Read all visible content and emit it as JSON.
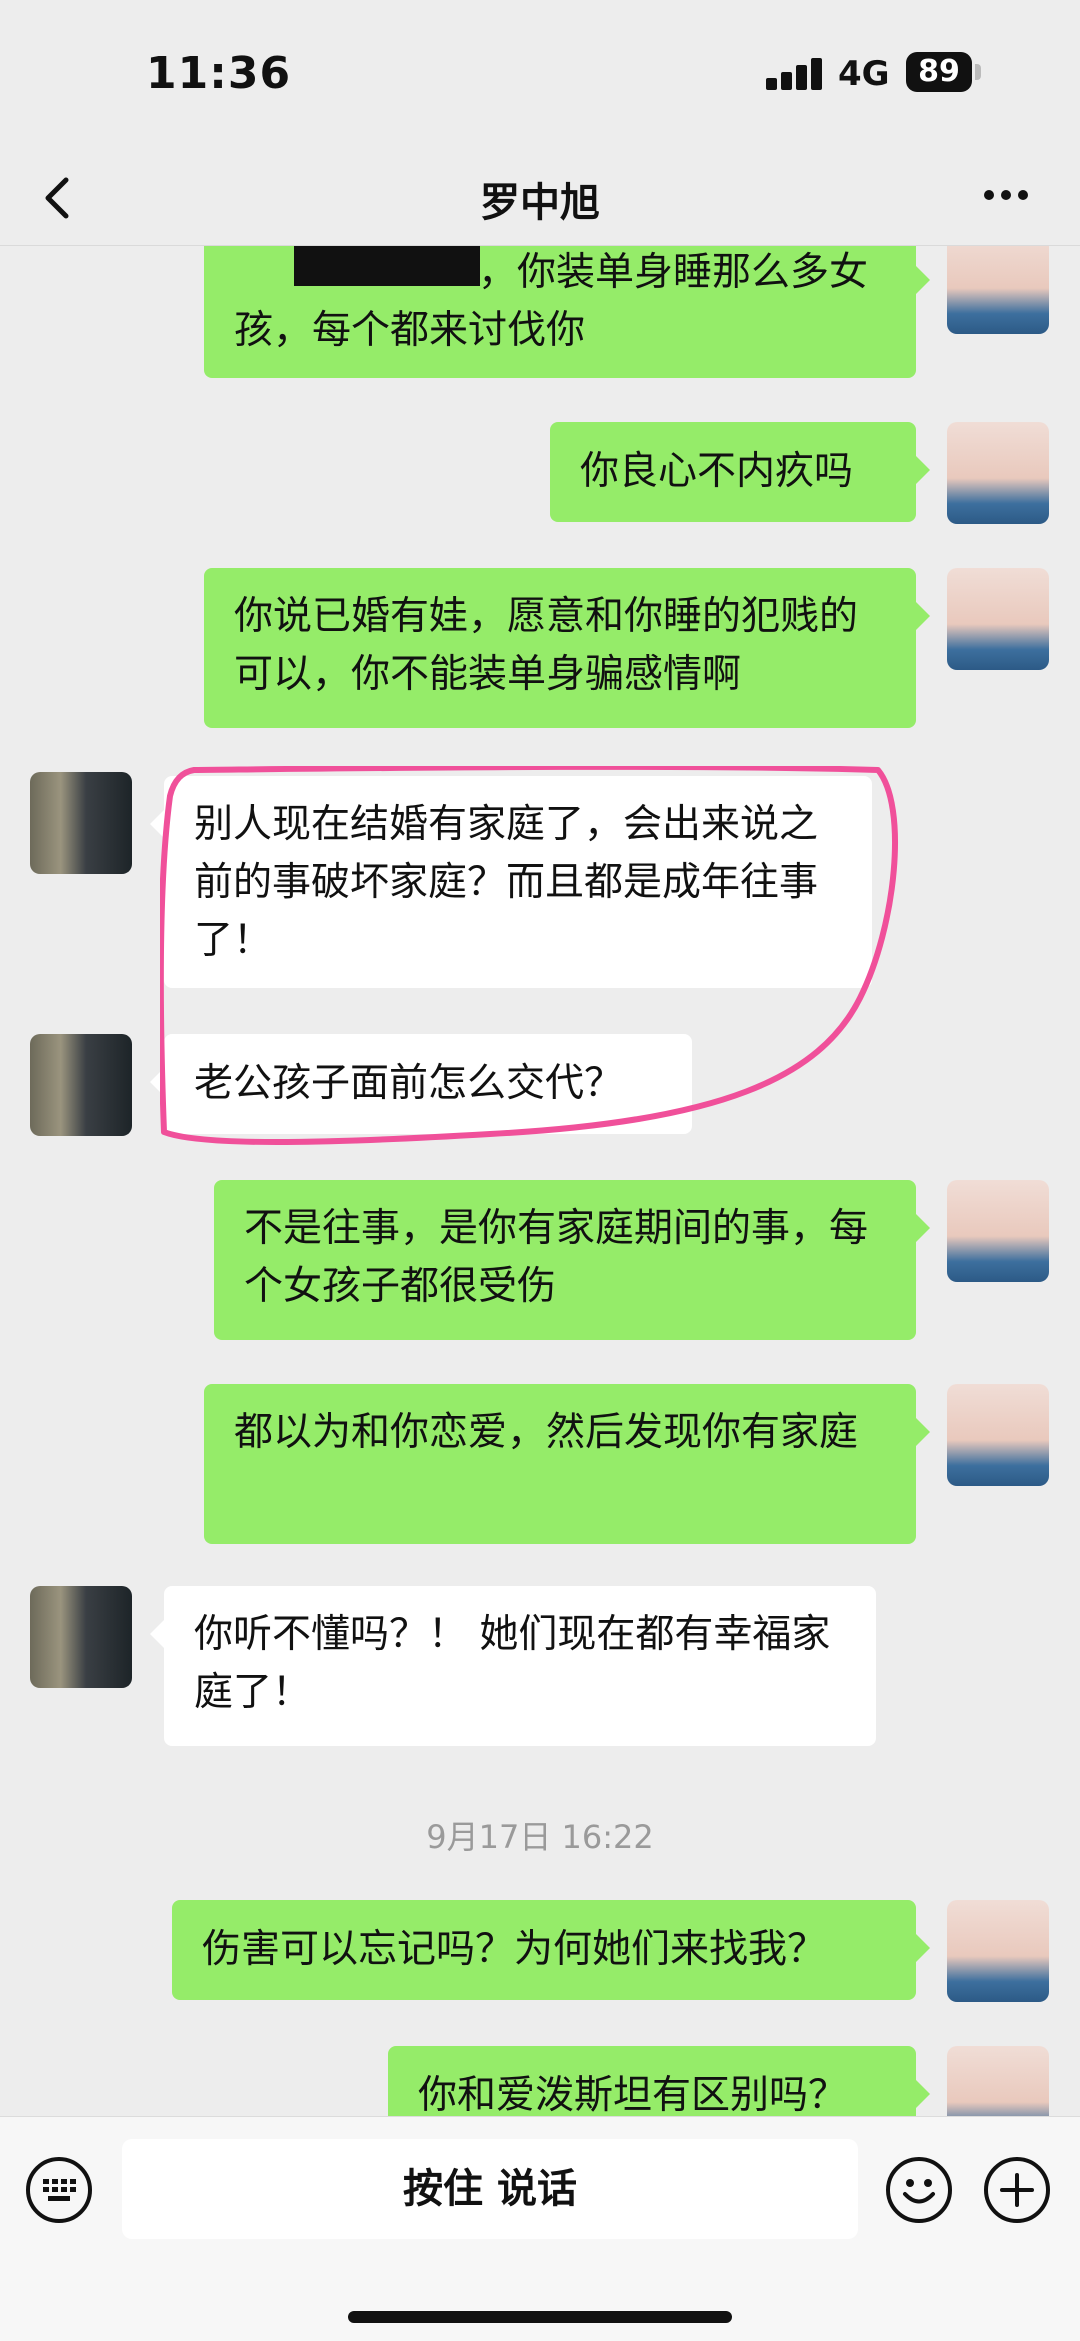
{
  "status_bar": {
    "time": "11:36",
    "network": "4G",
    "battery": "89"
  },
  "header": {
    "title": "罗中旭"
  },
  "messages": [
    {
      "side": "me",
      "text": "，你装单身睡那么多女孩，每个都来讨伐你"
    },
    {
      "side": "me",
      "text": "你良心不内疚吗"
    },
    {
      "side": "me",
      "text": "你说已婚有娃，愿意和你睡的犯贱的可以，你不能装单身骗感情啊"
    },
    {
      "side": "other",
      "text": "别人现在结婚有家庭了，会出来说之前的事破坏家庭？而且都是成年往事了！"
    },
    {
      "side": "other",
      "text": "老公孩子面前怎么交代？"
    },
    {
      "side": "me",
      "text": "不是往事，是你有家庭期间的事，每个女孩子都很受伤"
    },
    {
      "side": "me",
      "text": "都以为和你恋爱，然后发现你有家庭"
    },
    {
      "side": "other",
      "text": "你听不懂吗？！ 她们现在都有幸福家庭了！"
    },
    {
      "side": "me",
      "text": "伤害可以忘记吗？为何她们来找我？"
    },
    {
      "side": "me",
      "text": "你和爱泼斯坦有区别吗？"
    }
  ],
  "timestamp": "9月17日 16:22",
  "input_bar": {
    "hold_to_talk": "按住 说话"
  },
  "colors": {
    "background": "#ededed",
    "my_bubble": "#95ec69",
    "other_bubble": "#ffffff",
    "annotation": "#f0509a"
  },
  "icons": [
    "back-arrow-icon",
    "more-dots-icon",
    "keyboard-icon",
    "emoji-icon",
    "plus-icon"
  ]
}
